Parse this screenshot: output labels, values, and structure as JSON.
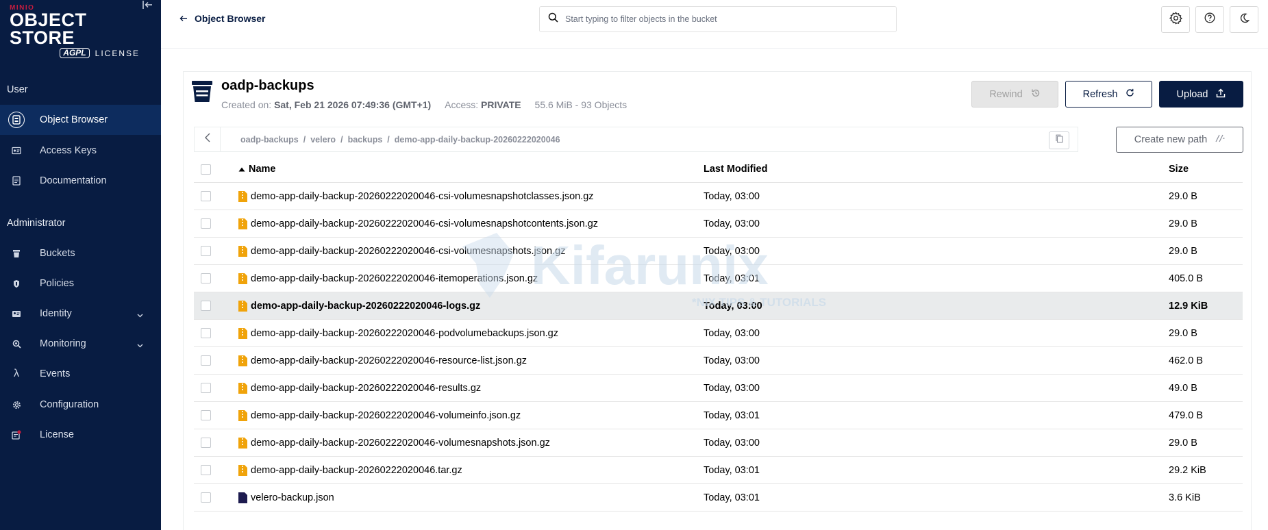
{
  "brand": {
    "minio": "MINIO",
    "title": "OBJECT STORE",
    "agpl": "AGPL",
    "license": "LICENSE"
  },
  "sidebar": {
    "user_section": "User",
    "admin_section": "Administrator",
    "user_items": [
      {
        "label": "Object Browser",
        "icon": "object-browser-icon"
      },
      {
        "label": "Access Keys",
        "icon": "key-icon"
      },
      {
        "label": "Documentation",
        "icon": "document-icon"
      }
    ],
    "admin_items": [
      {
        "label": "Buckets",
        "icon": "bucket-icon"
      },
      {
        "label": "Policies",
        "icon": "shield-icon"
      },
      {
        "label": "Identity",
        "icon": "id-card-icon"
      },
      {
        "label": "Monitoring",
        "icon": "magnifier-icon"
      },
      {
        "label": "Events",
        "icon": "lambda-icon"
      },
      {
        "label": "Configuration",
        "icon": "gear-icon"
      },
      {
        "label": "License",
        "icon": "license-icon"
      }
    ]
  },
  "topbar": {
    "back_label": "Object Browser",
    "search_placeholder": "Start typing to filter objects in the bucket"
  },
  "bucket": {
    "name": "oadp-backups",
    "created_label": "Created on:",
    "created_value": "Sat, Feb 21 2026 07:49:36 (GMT+1)",
    "access_label": "Access:",
    "access_value": "PRIVATE",
    "stats": "55.6 MiB - 93 Objects"
  },
  "actions": {
    "rewind": "Rewind",
    "refresh": "Refresh",
    "upload": "Upload",
    "create_path": "Create new path"
  },
  "breadcrumb": [
    "oadp-backups",
    "velero",
    "backups",
    "demo-app-daily-backup-20260222020046"
  ],
  "table": {
    "columns": {
      "name": "Name",
      "modified": "Last Modified",
      "size": "Size"
    },
    "rows": [
      {
        "name": "demo-app-daily-backup-20260222020046-csi-volumesnapshotclasses.json.gz",
        "modified": "Today, 03:00",
        "size": "29.0 B",
        "type": "archive"
      },
      {
        "name": "demo-app-daily-backup-20260222020046-csi-volumesnapshotcontents.json.gz",
        "modified": "Today, 03:00",
        "size": "29.0 B",
        "type": "archive"
      },
      {
        "name": "demo-app-daily-backup-20260222020046-csi-volumesnapshots.json.gz",
        "modified": "Today, 03:00",
        "size": "29.0 B",
        "type": "archive"
      },
      {
        "name": "demo-app-daily-backup-20260222020046-itemoperations.json.gz",
        "modified": "Today, 03:01",
        "size": "405.0 B",
        "type": "archive"
      },
      {
        "name": "demo-app-daily-backup-20260222020046-logs.gz",
        "modified": "Today, 03:00",
        "size": "12.9 KiB",
        "type": "archive",
        "selected": true
      },
      {
        "name": "demo-app-daily-backup-20260222020046-podvolumebackups.json.gz",
        "modified": "Today, 03:00",
        "size": "29.0 B",
        "type": "archive"
      },
      {
        "name": "demo-app-daily-backup-20260222020046-resource-list.json.gz",
        "modified": "Today, 03:00",
        "size": "462.0 B",
        "type": "archive"
      },
      {
        "name": "demo-app-daily-backup-20260222020046-results.gz",
        "modified": "Today, 03:00",
        "size": "49.0 B",
        "type": "archive"
      },
      {
        "name": "demo-app-daily-backup-20260222020046-volumeinfo.json.gz",
        "modified": "Today, 03:01",
        "size": "479.0 B",
        "type": "archive"
      },
      {
        "name": "demo-app-daily-backup-20260222020046-volumesnapshots.json.gz",
        "modified": "Today, 03:00",
        "size": "29.0 B",
        "type": "archive"
      },
      {
        "name": "demo-app-daily-backup-20260222020046.tar.gz",
        "modified": "Today, 03:01",
        "size": "29.2 KiB",
        "type": "archive"
      },
      {
        "name": "velero-backup.json",
        "modified": "Today, 03:01",
        "size": "3.6 KiB",
        "type": "file"
      }
    ]
  },
  "watermark": {
    "main": "Kifarunix",
    "sub": "*NIX TIPS & TUTORIALS"
  },
  "colors": {
    "sidebar_bg": "#081c42",
    "sidebar_active": "#0d2c5e",
    "archive_icon": "#f0a30a",
    "file_icon": "#1d1b4f",
    "brand_red": "#c51c3f"
  }
}
